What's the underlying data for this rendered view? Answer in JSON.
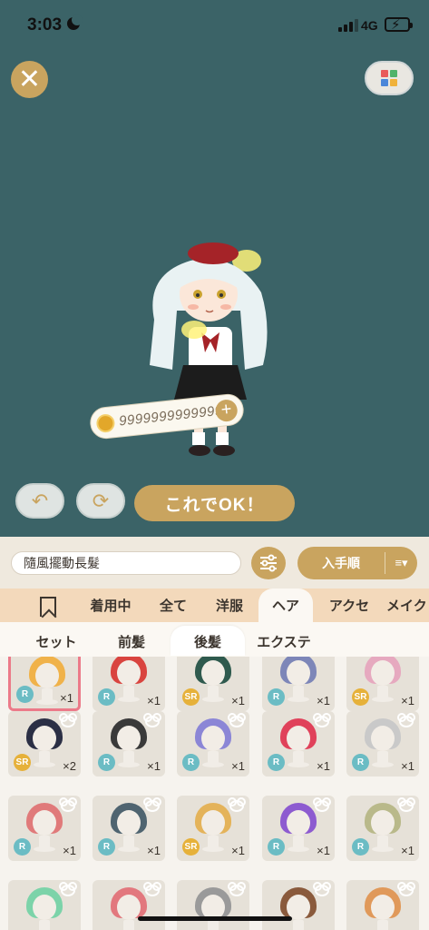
{
  "status_bar": {
    "time": "3:03",
    "network": "4G"
  },
  "colors": {
    "accent": "#c9a45f",
    "background": "#3b6367",
    "rarity_r": "#6bbcc4",
    "rarity_sr": "#e6b13a",
    "selected_border": "#ec7a89"
  },
  "toolbar": {
    "close_icon": "close-icon",
    "grid_icon": "color-grid-icon"
  },
  "avatar": {
    "coin_amount": "9999999999999"
  },
  "controls": {
    "undo_icon": "undo-icon",
    "refresh_icon": "refresh-icon",
    "ok_label": "これでOK！"
  },
  "filter_bar": {
    "item_name": "隨風擺動長髮",
    "sort_label": "入手順",
    "filter_icon": "sliders-icon",
    "sort_icon": "sort-order-icon"
  },
  "category_tabs": [
    {
      "label": ""
    },
    {
      "label": "着用中"
    },
    {
      "label": "全て"
    },
    {
      "label": "洋服"
    },
    {
      "label": "ヘア"
    },
    {
      "label": "アクセ"
    },
    {
      "label": "メイク"
    }
  ],
  "active_category": "ヘア",
  "sub_tabs": [
    {
      "label": "セット"
    },
    {
      "label": "前髪"
    },
    {
      "label": "後髪"
    },
    {
      "label": "エクステ"
    }
  ],
  "active_sub_tab": "後髪",
  "items": [
    {
      "rarity": "R",
      "count": "×1",
      "hair": "#f0b24a",
      "selected": true
    },
    {
      "rarity": "R",
      "count": "×1",
      "hair": "#d9443f"
    },
    {
      "rarity": "SR",
      "count": "×1",
      "hair": "#2f5a4e"
    },
    {
      "rarity": "R",
      "count": "×1",
      "hair": "#7d86b8"
    },
    {
      "rarity": "SR",
      "count": "×1",
      "hair": "#e6a9bf"
    },
    {
      "rarity": "SR",
      "count": "×2",
      "hair": "#2b2f45"
    },
    {
      "rarity": "R",
      "count": "×1",
      "hair": "#3a3a3a"
    },
    {
      "rarity": "R",
      "count": "×1",
      "hair": "#8b86d6"
    },
    {
      "rarity": "R",
      "count": "×1",
      "hair": "#e0415a"
    },
    {
      "rarity": "R",
      "count": "×1",
      "hair": "#c9c9c9"
    },
    {
      "rarity": "R",
      "count": "×1",
      "hair": "#e07a7a"
    },
    {
      "rarity": "R",
      "count": "×1",
      "hair": "#4f6470"
    },
    {
      "rarity": "SR",
      "count": "×1",
      "hair": "#e4b35a"
    },
    {
      "rarity": "R",
      "count": "×1",
      "hair": "#8d5bd0"
    },
    {
      "rarity": "R",
      "count": "×1",
      "hair": "#b9b98a"
    },
    {
      "rarity": "",
      "count": "",
      "hair": "#7cd3a9"
    },
    {
      "rarity": "",
      "count": "",
      "hair": "#e2787e"
    },
    {
      "rarity": "",
      "count": "",
      "hair": "#9a9a9a"
    },
    {
      "rarity": "",
      "count": "",
      "hair": "#8a5a3c"
    },
    {
      "rarity": "",
      "count": "",
      "hair": "#e0995a"
    }
  ]
}
